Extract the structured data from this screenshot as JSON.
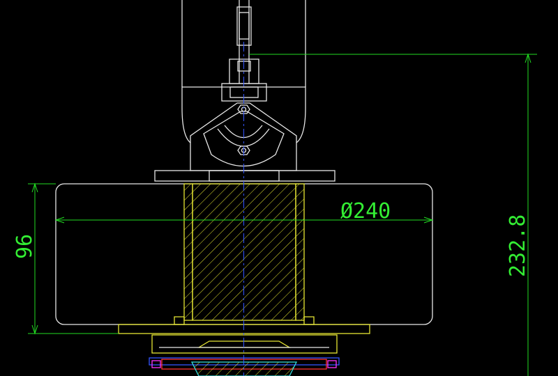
{
  "drawing": {
    "background_color": "#000000",
    "colors": {
      "outline": "#e8e8e8",
      "dimension": "#22dd22",
      "section": "#e6e633",
      "centerline": "#3355ff",
      "red_layer": "#ff3333",
      "magenta_layer": "#ff33ff",
      "cyan_layer": "#33dddd"
    },
    "dimensions": {
      "diameter_label": "Ø240",
      "height_label": "96",
      "total_height_label": "232.8"
    }
  }
}
